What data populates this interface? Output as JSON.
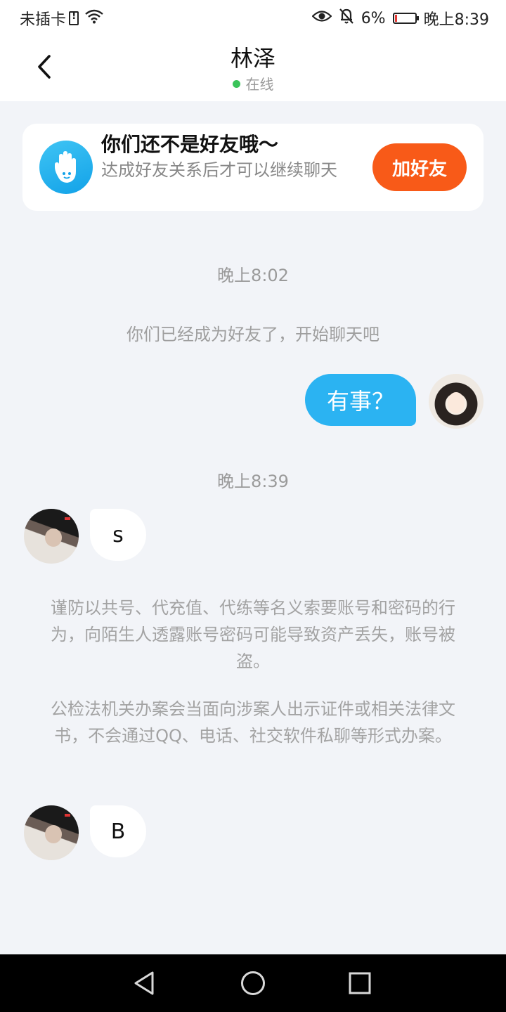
{
  "status_bar": {
    "carrier": "未插卡",
    "battery_percent": "6%",
    "time": "晚上8:39",
    "battery_level": 0.06
  },
  "header": {
    "title": "林泽",
    "status": "在线"
  },
  "friend_card": {
    "title": "你们还不是好友哦～",
    "description": "达成好友关系后才可以继续聊天",
    "button": "加好友"
  },
  "chat": {
    "timestamp_1": "晚上8:02",
    "system_message": "你们已经成为好友了，开始聊天吧",
    "outgoing_message": "有事？",
    "timestamp_2": "晚上8:39",
    "incoming_1": "s",
    "notice_1": "谨防以共号、代充值、代练等名义索要账号和密码的行为，向陌生人透露账号密码可能导致资产丢失，账号被盗。",
    "notice_2": "公检法机关办案会当面向涉案人出示证件或相关法律文书，不会通过QQ、电话、社交软件私聊等形式办案。",
    "incoming_2": "B"
  },
  "colors": {
    "accent_blue": "#2bb3f2",
    "add_button": "#f85a18",
    "online": "#3bc45a"
  },
  "icons": [
    "back-arrow-icon",
    "wave-hand-icon",
    "eye-icon",
    "bell-off-icon",
    "wifi-icon",
    "battery-icon",
    "nav-back-icon",
    "nav-home-icon",
    "nav-recents-icon"
  ]
}
